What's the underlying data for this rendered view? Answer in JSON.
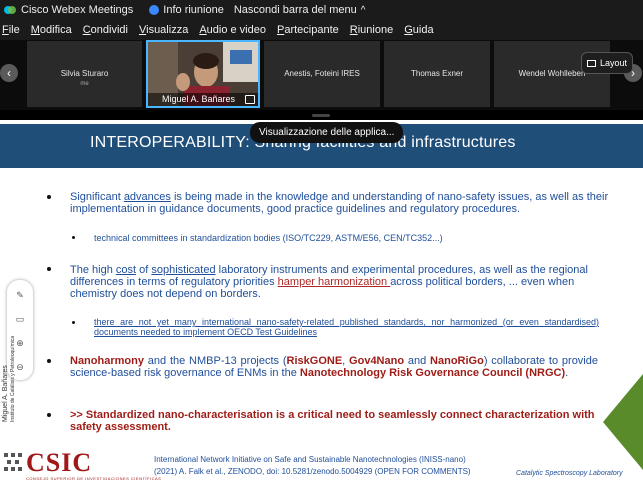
{
  "titlebar": {
    "app_name": "Cisco Webex Meetings",
    "info": "Info riunione",
    "hide_menu": "Nascondi barra del menu",
    "hide_chevron": "^"
  },
  "menu": [
    {
      "key": "F",
      "rest": "ile"
    },
    {
      "key": "M",
      "rest": "odifica"
    },
    {
      "key": "C",
      "rest": "ondividi"
    },
    {
      "key": "V",
      "rest": "isualizza"
    },
    {
      "key": "A",
      "rest": "udio e video"
    },
    {
      "key": "P",
      "rest": "artecipante"
    },
    {
      "key": "R",
      "rest": "iunione"
    },
    {
      "key": "G",
      "rest": "uida"
    }
  ],
  "participants": [
    {
      "name": "Silvia Sturaro",
      "sub": "me"
    },
    {
      "name": "Miguel A. Bañares",
      "active": true
    },
    {
      "name": "Anestis, Foteini IRES"
    },
    {
      "name": "Thomas Exner"
    },
    {
      "name": "Wendel Wohlleben"
    }
  ],
  "layout_button": "Layout",
  "tooltip": "Visualizzazione delle applica...",
  "slide": {
    "title": "INTEROPERABILITY: Sharing facilities and infrastructures",
    "b1_pre": "Significant ",
    "b1_link": "advances",
    "b1_post": " is being made in the knowledge and understanding of nano-safety issues, as well as their implementation in guidance documents, good practice guidelines and regulatory procedures.",
    "b1_sub": "technical committees in standardization bodies (ISO/TC229, ASTM/E56, CEN/TC352...)",
    "b2_a": "The high ",
    "b2_cost": "cost",
    "b2_b": " of ",
    "b2_soph": "sophisticated",
    "b2_c": " laboratory instruments and experimental procedures, as well as the regional differences in terms of regulatory priorities ",
    "b2_hamper": "hamper harmonization ",
    "b2_d": "across political borders, ... even when chemistry does not depend on borders.",
    "b2_sub": "there are not yet many international nano-safety-related published standards, nor harmonized (or even standardised) documents needed to implement OECD Test Guidelines",
    "b3_1": "Nanoharmony",
    "b3_2": " and the NMBP-13 projects (",
    "b3_3": "RiskGONE",
    "b3_4": ", ",
    "b3_5": "Gov4Nano",
    "b3_6": " and ",
    "b3_7": "NanoRiGo",
    "b3_8": ") collaborate to provide science-based risk governance of ENMs in the ",
    "b3_9": "Nanotechnology Risk Governance Council (NRGC)",
    "b3_10": ".",
    "b4": ">> Standardized nano-characterisation is a critical need to seamlessly connect characterization with safety assessment.",
    "vertical_text": "Miguel A. Bañares",
    "vertical_sub": "Instituto de Catálisis y Petroleoquímica",
    "csic": "CSIC",
    "csic_sub": "CONSEJO SUPERIOR DE INVESTIGACIONES CIENTÍFICAS",
    "ref1": "International Network Initiative on Safe and Sustainable Nanotechnologies (INISS-nano)",
    "ref2": "(2021) A. Falk et al., ZENODO, doi: 10.5281/zenodo.5004929 (OPEN FOR COMMENTS)",
    "lab": "Catalytic Spectroscopy Laboratory"
  },
  "icons": {
    "brand": "webex-logo-icon",
    "info": "info-icon",
    "prev": "chevron-left-icon",
    "next": "chevron-right-icon",
    "layout": "layout-icon",
    "share": "share-screen-icon",
    "pen": "pen-icon",
    "eraser": "eraser-icon",
    "zoom_in": "zoom-in-icon",
    "zoom_out": "zoom-out-icon"
  },
  "colors": {
    "banner": "#1f4e79",
    "text_blue": "#1f4e9a",
    "accent_red": "#9e1b16",
    "active_border": "#49b6ff"
  }
}
